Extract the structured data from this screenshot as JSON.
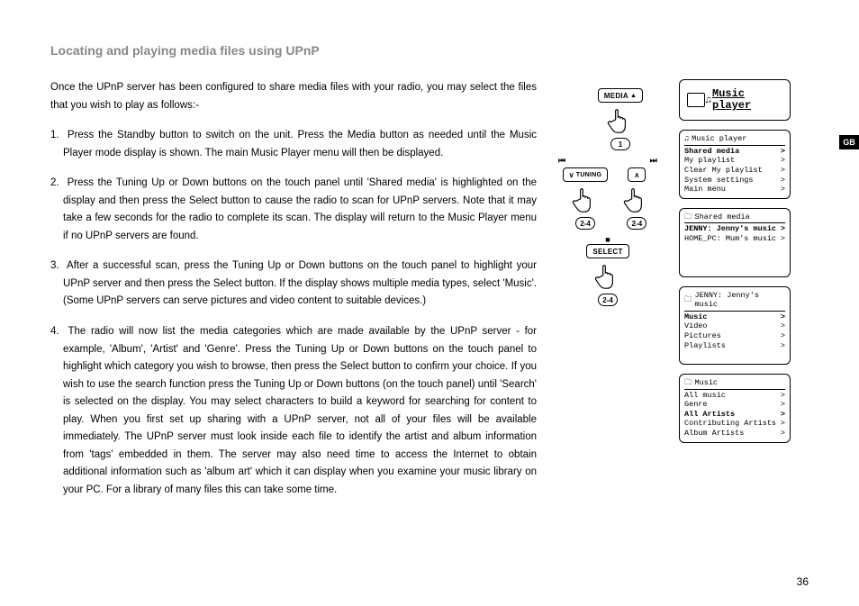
{
  "heading": "Locating and playing media files using UPnP",
  "intro": "Once the UPnP server has been configured to share media files with your radio, you may select the files that you wish to play as follows:-",
  "steps": [
    "Press the Standby button to switch on the unit. Press the Media button as needed until the Music Player mode display is shown. The main Music Player menu will then be displayed.",
    "Press the Tuning Up or Down buttons on the touch panel until 'Shared media' is highlighted on the display and then press the Select button to cause the radio to scan for UPnP servers. Note that it may take a few seconds for the radio to complete its scan. The display will return to the Music Player menu if no UPnP servers are found.",
    "After a successful scan, press the Tuning Up or Down buttons on the touch panel to highlight your UPnP server and then press the Select button. If the display shows multiple media types, select 'Music'. (Some UPnP servers can serve pictures and video content to suitable devices.)",
    "The radio will now list the media categories which are made available by the UPnP server - for example, 'Album', 'Artist' and 'Genre'. Press the Tuning Up or Down buttons on the touch panel to highlight which category you wish to browse, then press the Select button to confirm your choice. If you wish to use the search function press the Tuning Up or Down buttons (on the touch panel) until 'Search' is selected on the display. You may select characters to build a keyword for searching for content to play. When you first set up sharing with a UPnP server, not all of your files will be available immediately. The UPnP server must look inside each file to identify the artist and album information from 'tags' embedded in them. The server may also need time to access the Internet to obtain additional information such as 'album art' which it can display when you examine your music library on your PC. For a library of many files this can take some time."
  ],
  "diagram": {
    "media_label": "MEDIA",
    "media_badge": "1",
    "tuning_label": "TUNING",
    "tuning_badge": "2-4",
    "select_label": "SELECT",
    "select_badge": "2-4",
    "prev": "⏮",
    "next": "⏭",
    "down": "∨",
    "up": "∧",
    "stop": "■"
  },
  "lcd_big_title": "Music player",
  "lcd_menus": [
    {
      "header_icon": "♫",
      "header": "Music player",
      "rows": [
        {
          "label": "Shared media",
          "bold": true
        },
        {
          "label": "My playlist"
        },
        {
          "label": "Clear My playlist"
        },
        {
          "label": "System settings"
        },
        {
          "label": "Main menu"
        }
      ]
    },
    {
      "header_icon": "🗀",
      "header": "Shared media",
      "rows": [
        {
          "label": "JENNY: Jenny's music",
          "bold": true
        },
        {
          "label": "HOME_PC: Mum's music"
        }
      ],
      "pad": 3
    },
    {
      "header_icon": "🗀",
      "header": "JENNY: Jenny's music",
      "rows": [
        {
          "label": "Music",
          "bold": true
        },
        {
          "label": "Video"
        },
        {
          "label": "Pictures"
        },
        {
          "label": "Playlists"
        }
      ],
      "pad": 1
    },
    {
      "header_icon": "🗀",
      "header": "Music",
      "rows": [
        {
          "label": "All music"
        },
        {
          "label": "Genre"
        },
        {
          "label": "All Artists",
          "bold": true
        },
        {
          "label": "Contributing Artists"
        },
        {
          "label": "Album Artists"
        }
      ]
    }
  ],
  "side_tab": "GB",
  "page_number": "36"
}
